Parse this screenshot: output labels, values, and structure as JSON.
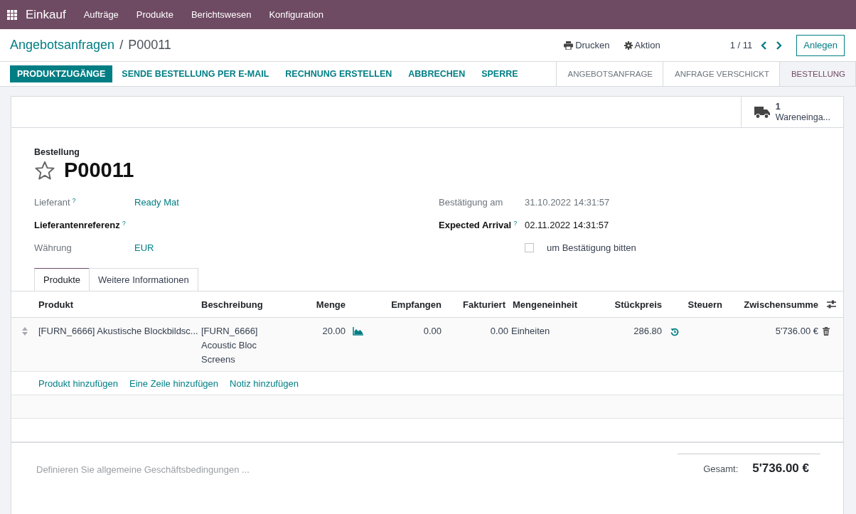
{
  "navbar": {
    "app": "Einkauf",
    "menu": [
      "Aufträge",
      "Produkte",
      "Berichtswesen",
      "Konfiguration"
    ]
  },
  "breadcrumb": {
    "parent": "Angebotsanfragen",
    "separator": "/",
    "current": "P00011"
  },
  "actions": [
    {
      "kind": "print",
      "label": "Drucken"
    },
    {
      "kind": "gear",
      "label": "Aktion"
    }
  ],
  "pager": "1 / 11",
  "create_button": "Anlegen",
  "status_buttons": [
    {
      "label": "PRODUKTZUGÄNGE",
      "primary": true
    },
    {
      "label": "SENDE BESTELLUNG PER E-MAIL",
      "primary": false
    },
    {
      "label": "RECHNUNG ERSTELLEN",
      "primary": false
    },
    {
      "label": "ABBRECHEN",
      "primary": false
    },
    {
      "label": "SPERRE",
      "primary": false
    }
  ],
  "stages": [
    {
      "label": "ANGEBOTSANFRAGE",
      "selected": false
    },
    {
      "label": "ANFRAGE VERSCHICKT",
      "selected": false
    },
    {
      "label": "BESTELLUNG",
      "selected": true
    }
  ],
  "smart_button": {
    "count": "1",
    "label": "Wareneinga..."
  },
  "form": {
    "type_label": "Bestellung",
    "name": "P00011",
    "starred": false,
    "left_fields": [
      {
        "label": "Lieferant",
        "help": "?",
        "required": false,
        "value": "Ready Mat",
        "kind": "link"
      },
      {
        "label": "Lieferantenreferenz",
        "help": "?",
        "required": true
      },
      {
        "label": "Währung",
        "required": false,
        "value": "EUR",
        "kind": "link"
      }
    ],
    "right_fields": [
      {
        "label": "Bestätigung am",
        "required": false,
        "value": "31.10.2022 14:31:57",
        "kind": "readonly"
      },
      {
        "label": "Expected Arrival",
        "help": "?",
        "required": true,
        "value": "02.11.2022 14:31:57",
        "kind": "input"
      }
    ],
    "checkbox": {
      "label": "um Bestätigung bitten",
      "checked": false
    }
  },
  "tabs": [
    {
      "label": "Produkte",
      "selected": true
    },
    {
      "label": "Weitere Informationen",
      "selected": false
    }
  ],
  "table": {
    "columns": [
      "Produkt",
      "Beschreibung",
      "Menge",
      "Empfangen",
      "Fakturiert",
      "Mengeneinheit",
      "Stückpreis",
      "Steuern",
      "Zwischensumme"
    ],
    "rows": [
      {
        "product": "[FURN_6666] Akustische Blockbildsc...",
        "description": "[FURN_6666] Acoustic Bloc Screens",
        "quantity": "20.00",
        "received": "0.00",
        "invoiced": "0.00",
        "uom": "Einheiten",
        "price": "286.80",
        "subtotal": "5'736.00 €"
      }
    ],
    "add_links": [
      "Produkt hinzufügen",
      "Eine Zeile hinzufügen",
      "Notiz hinzufügen"
    ]
  },
  "footer": {
    "terms_placeholder": "Definieren Sie allgemeine Geschäftsbedingungen ...",
    "total_label": "Gesamt:",
    "total_value": "5'736.00 €"
  }
}
